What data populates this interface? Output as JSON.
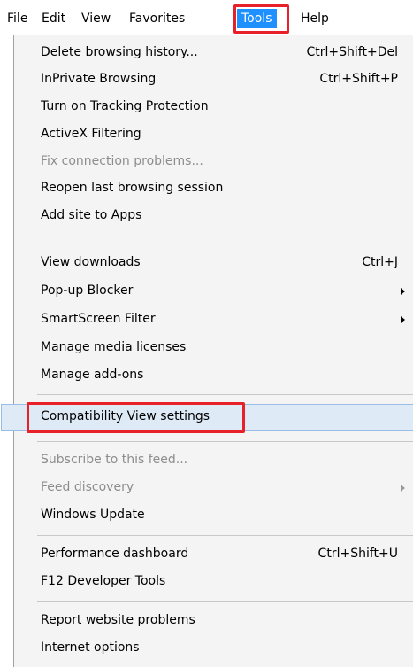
{
  "menubar": {
    "items": [
      "File",
      "Edit",
      "View",
      "Favorites",
      "Tools",
      "Help"
    ],
    "active": "Tools"
  },
  "menu": {
    "items": [
      {
        "label": "Delete browsing history...",
        "shortcut": "Ctrl+Shift+Del",
        "enabled": true
      },
      {
        "label": "InPrivate Browsing",
        "shortcut": "Ctrl+Shift+P",
        "enabled": true
      },
      {
        "label": "Turn on Tracking Protection",
        "shortcut": "",
        "enabled": true
      },
      {
        "label": "ActiveX Filtering",
        "shortcut": "",
        "enabled": true
      },
      {
        "label": "Fix connection problems...",
        "shortcut": "",
        "enabled": false
      },
      {
        "label": "Reopen last browsing session",
        "shortcut": "",
        "enabled": true
      },
      {
        "label": "Add site to Apps",
        "shortcut": "",
        "enabled": true
      },
      {
        "label": "View downloads",
        "shortcut": "Ctrl+J",
        "enabled": true
      },
      {
        "label": "Pop-up Blocker",
        "shortcut": "",
        "enabled": true,
        "submenu": true
      },
      {
        "label": "SmartScreen Filter",
        "shortcut": "",
        "enabled": true,
        "submenu": true
      },
      {
        "label": "Manage media licenses",
        "shortcut": "",
        "enabled": true
      },
      {
        "label": "Manage add-ons",
        "shortcut": "",
        "enabled": true
      },
      {
        "label": "Compatibility View settings",
        "shortcut": "",
        "enabled": true,
        "highlighted": true
      },
      {
        "label": "Subscribe to this feed...",
        "shortcut": "",
        "enabled": false
      },
      {
        "label": "Feed discovery",
        "shortcut": "",
        "enabled": false,
        "submenu": true
      },
      {
        "label": "Windows Update",
        "shortcut": "",
        "enabled": true
      },
      {
        "label": "Performance dashboard",
        "shortcut": "Ctrl+Shift+U",
        "enabled": true
      },
      {
        "label": "F12 Developer Tools",
        "shortcut": "",
        "enabled": true
      },
      {
        "label": "Report website problems",
        "shortcut": "",
        "enabled": true
      },
      {
        "label": "Internet options",
        "shortcut": "",
        "enabled": true
      }
    ]
  },
  "colors": {
    "menu_background": "#f4f4f4",
    "active_menu_background": "#1e90ff",
    "annotation_outline": "#e8202a",
    "hover_background": "#dfeaf7",
    "disabled_text": "#8d8d8d"
  }
}
